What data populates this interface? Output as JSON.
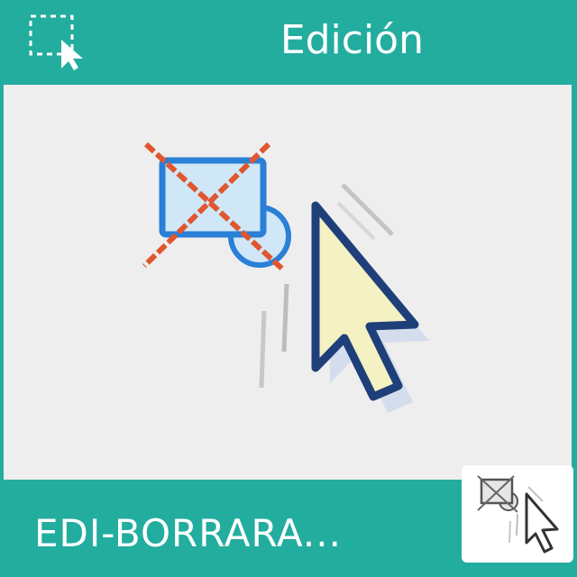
{
  "header": {
    "title": "Edición",
    "icon": "selection-cursor-icon"
  },
  "main": {
    "icon": "delete-shape-cursor-icon"
  },
  "footer": {
    "label": "EDI-BORRARA...",
    "thumbnail_icon": "delete-shape-cursor-icon"
  },
  "colors": {
    "accent": "#22ad9f",
    "panel": "#eeeeee",
    "cross": "#e0562f",
    "shape_blue": "#2a7fd6",
    "cursor_fill": "#f4f1c2",
    "cursor_outline": "#1e3f7a"
  }
}
